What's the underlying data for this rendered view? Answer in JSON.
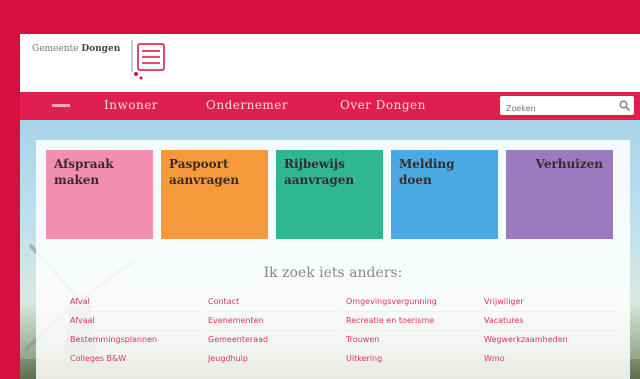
{
  "header": {
    "logo_prefix": "Gemeente",
    "logo_name": "Dongen"
  },
  "nav": {
    "items": [
      "Inwoner",
      "Ondernemer",
      "Over Dongen"
    ],
    "search_placeholder": "Zoeken"
  },
  "tiles": [
    {
      "line1": "Afspraak",
      "line2": "maken",
      "color": "#f28fb0"
    },
    {
      "line1": "Paspoort",
      "line2": "aanvragen",
      "color": "#f59a3c"
    },
    {
      "line1": "Rijbewijs",
      "line2": "aanvragen",
      "color": "#2fb790"
    },
    {
      "line1": "Melding",
      "line2": "doen",
      "color": "#4aa8e2"
    },
    {
      "line1": "Verhuizen",
      "line2": "",
      "color": "#9b7bc0"
    }
  ],
  "other": {
    "heading": "Ik zoek iets anders:",
    "columns": [
      [
        "Afval",
        "Afvaal",
        "Bestemmingsplannen",
        "Colleges B&W"
      ],
      [
        "Contact",
        "Evenementen",
        "Gemeenteraad",
        "Jeugdhulp"
      ],
      [
        "Omgevingsvergunning",
        "Recreatie en toerisme",
        "Trouwen",
        "Uitkering"
      ],
      [
        "Vrijwiliger",
        "Vacatures",
        "Wegwerkzaamheden",
        "Wmo"
      ]
    ]
  },
  "colors": {
    "brand": "#d5103f",
    "nav": "#e11f4f"
  },
  "icons": [
    "home-icon",
    "search-icon",
    "crest-icon",
    "windmill-icon"
  ]
}
